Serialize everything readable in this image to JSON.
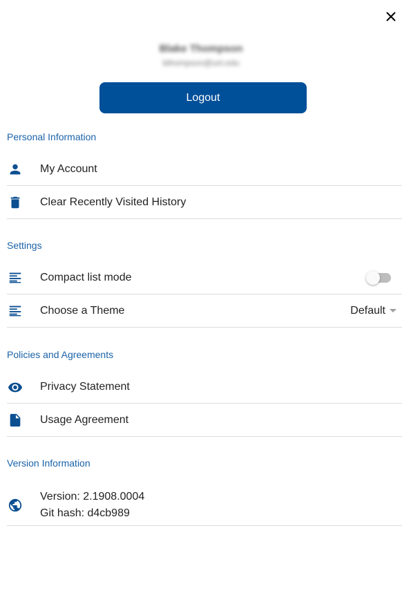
{
  "profile": {
    "name": "Blake Thompson",
    "email": "bthompson@uni.edu"
  },
  "logout_label": "Logout",
  "sections": {
    "personal": {
      "title": "Personal Information",
      "items": [
        "My Account",
        "Clear Recently Visited History"
      ]
    },
    "settings": {
      "title": "Settings",
      "compact_label": "Compact list mode",
      "compact_enabled": false,
      "theme_label": "Choose a Theme",
      "theme_value": "Default"
    },
    "policies": {
      "title": "Policies and Agreements",
      "items": [
        "Privacy Statement",
        "Usage Agreement"
      ]
    },
    "version": {
      "title": "Version Information",
      "version_line": "Version: 2.1908.0004",
      "hash_line": "Git hash: d4cb989"
    }
  },
  "icons": {
    "close": "close-icon",
    "account": "person-icon",
    "history": "trash-icon",
    "compact": "list-icon",
    "theme": "list-icon",
    "privacy": "eye-icon",
    "usage": "document-icon",
    "version": "globe-icon"
  },
  "colors": {
    "accent": "#004f99",
    "section_title": "#1a62a8",
    "icon": "#0b4f91"
  }
}
